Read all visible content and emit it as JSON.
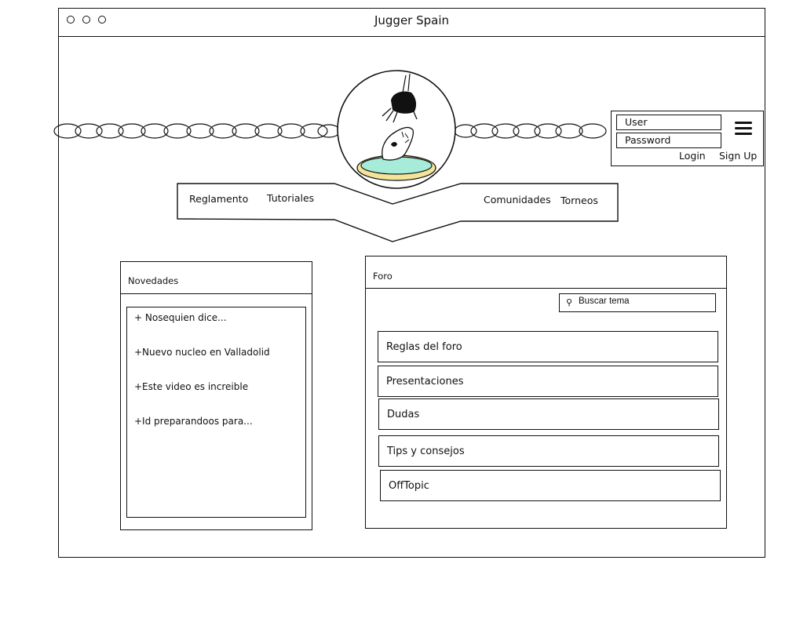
{
  "window": {
    "title": "Jugger Spain"
  },
  "login": {
    "user_placeholder": "User",
    "password_placeholder": "Password",
    "login_label": "Login",
    "signup_label": "Sign Up"
  },
  "nav": {
    "items": [
      "Reglamento",
      "Tutoriales",
      "Comunidades",
      "Torneos"
    ]
  },
  "news": {
    "title": "Novedades",
    "items": [
      "+ Nosequien dice...",
      "+Nuevo nucleo en Valladolid",
      "+Este video es increible",
      "+Id preparandoos para..."
    ]
  },
  "forum": {
    "title": "Foro",
    "search_placeholder": "Buscar tema",
    "topics": [
      "Reglas del foro",
      "Presentaciones",
      "Dudas",
      "Tips y consejos",
      "OffTopic"
    ]
  }
}
